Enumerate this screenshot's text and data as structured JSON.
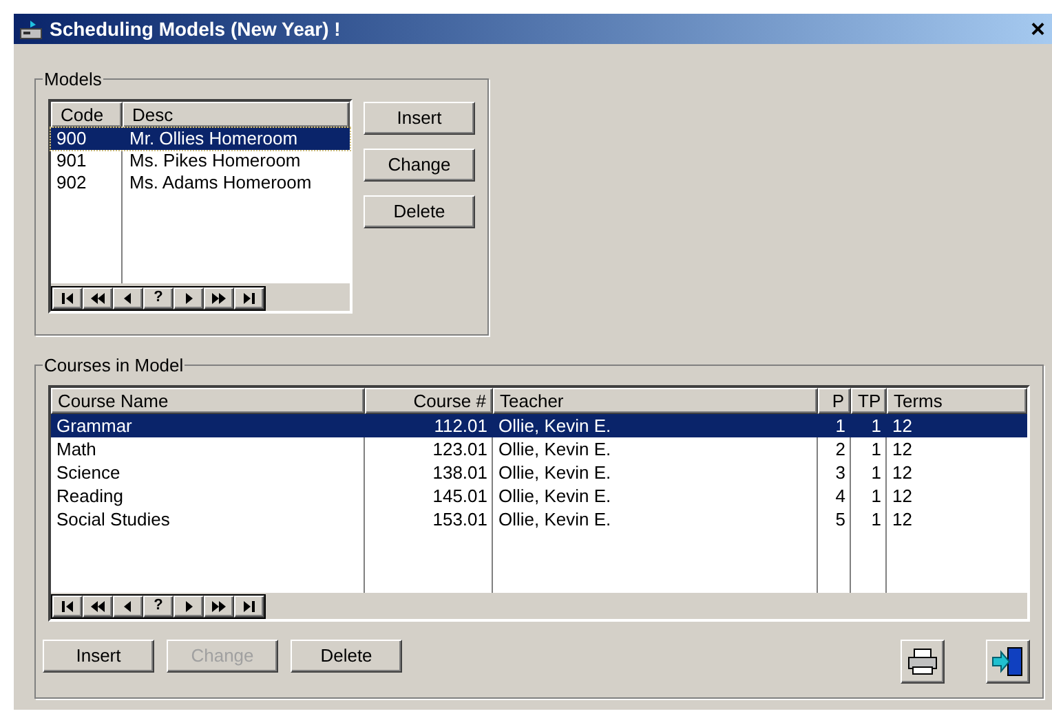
{
  "window": {
    "title": "Scheduling Models (New Year) !",
    "close": "×"
  },
  "models": {
    "title": "Models",
    "columns": [
      "Code",
      "Desc"
    ],
    "rows": [
      {
        "cells": [
          "900",
          "Mr. Ollies Homeroom"
        ],
        "selected": true
      },
      {
        "cells": [
          "901",
          "Ms. Pikes Homeroom"
        ],
        "selected": false
      },
      {
        "cells": [
          "902",
          "Ms. Adams Homeroom"
        ],
        "selected": false
      }
    ],
    "navigator": {
      "help": "?"
    },
    "buttons": [
      {
        "label": "Insert",
        "disabled": false
      },
      {
        "label": "Change",
        "disabled": false
      },
      {
        "label": "Delete",
        "disabled": false
      }
    ]
  },
  "courses": {
    "title": "Courses in Model",
    "columns": [
      "Course Name",
      "Course #",
      "Teacher",
      "P",
      "TP",
      "Terms"
    ],
    "rows": [
      {
        "cells": [
          "Grammar",
          "112.01",
          "Ollie, Kevin E.",
          "1",
          "1",
          "12"
        ],
        "selected": true
      },
      {
        "cells": [
          "Math",
          "123.01",
          "Ollie, Kevin E.",
          "2",
          "1",
          "12"
        ],
        "selected": false
      },
      {
        "cells": [
          "Science",
          "138.01",
          "Ollie, Kevin E.",
          "3",
          "1",
          "12"
        ],
        "selected": false
      },
      {
        "cells": [
          "Reading",
          "145.01",
          "Ollie, Kevin E.",
          "4",
          "1",
          "12"
        ],
        "selected": false
      },
      {
        "cells": [
          "Social Studies",
          "153.01",
          "Ollie, Kevin E.",
          "5",
          "1",
          "12"
        ],
        "selected": false
      }
    ],
    "navigator": {
      "help": "?"
    },
    "buttons": [
      {
        "label": "Insert",
        "disabled": false
      },
      {
        "label": "Change",
        "disabled": true
      },
      {
        "label": "Delete",
        "disabled": false
      }
    ]
  }
}
